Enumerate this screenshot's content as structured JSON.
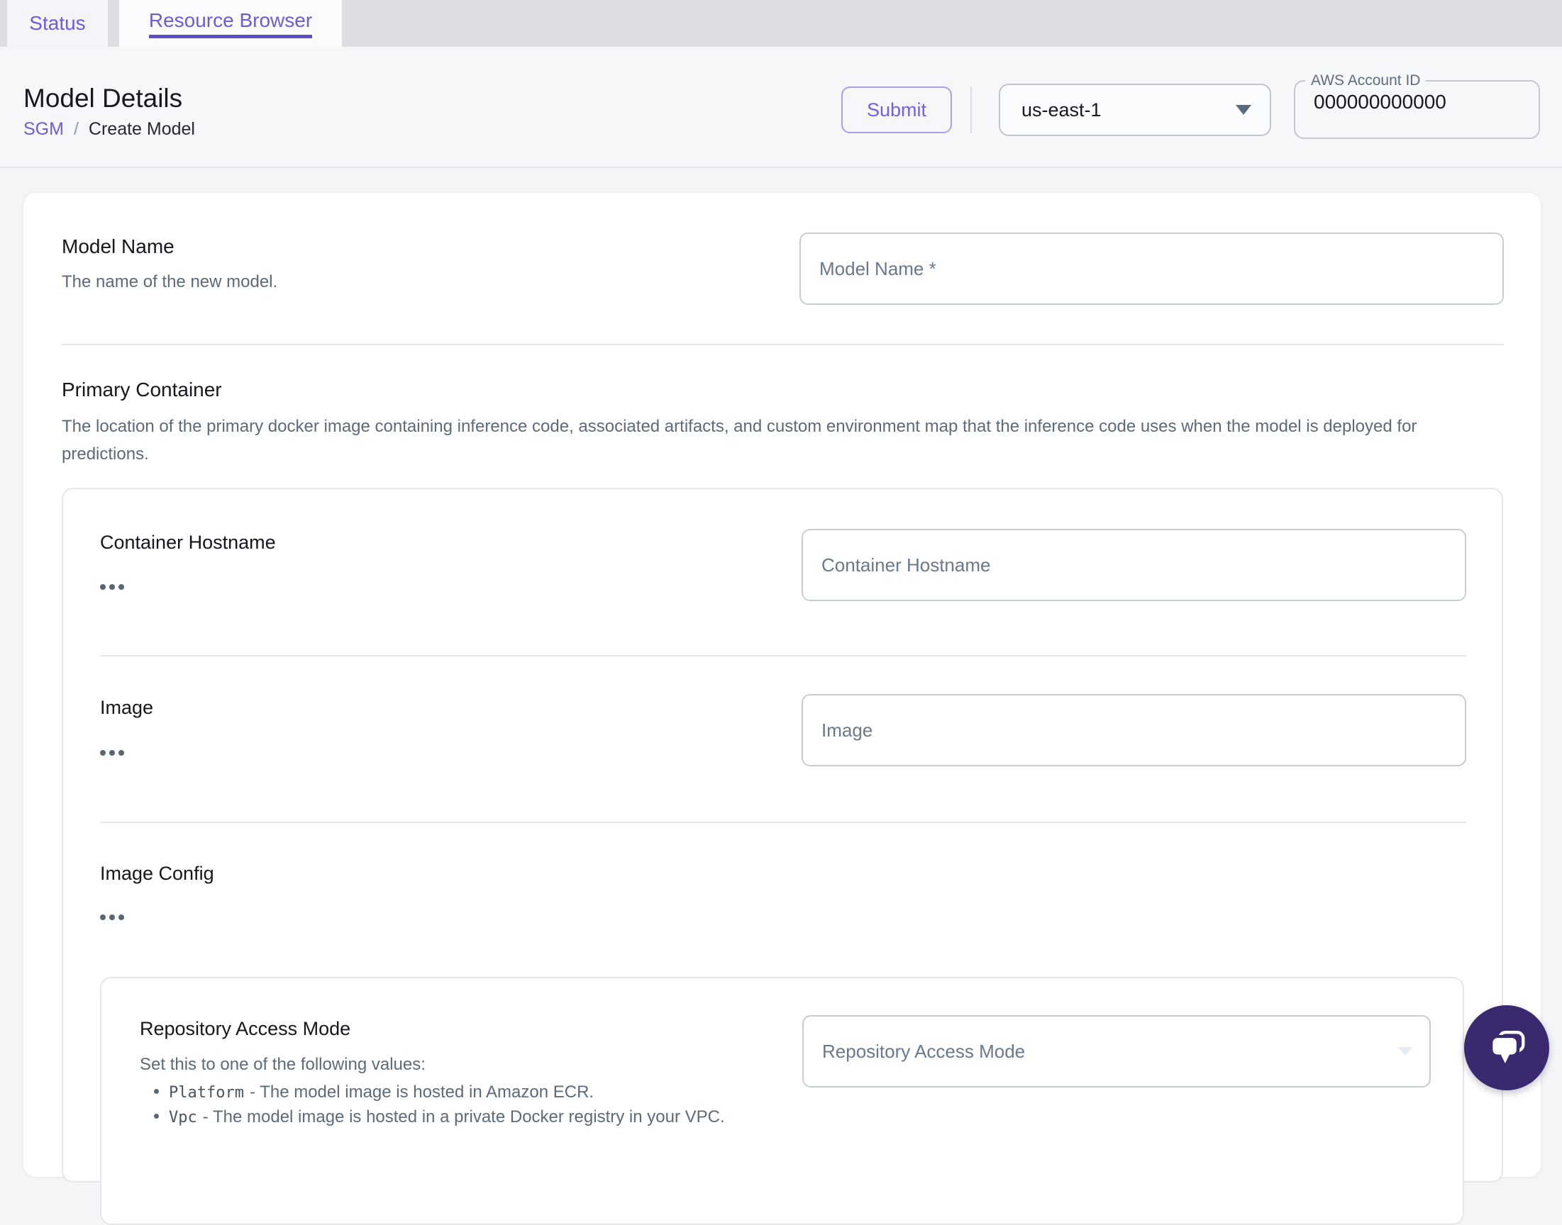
{
  "tabs": {
    "status": "Status",
    "resource_browser": "Resource Browser"
  },
  "header": {
    "title": "Model Details",
    "breadcrumb": {
      "root": "SGM",
      "separator": "/",
      "current": "Create Model"
    },
    "submit_label": "Submit",
    "region_select": {
      "value": "us-east-1"
    },
    "account_field": {
      "label": "AWS Account ID",
      "value": "000000000000"
    }
  },
  "form": {
    "model_name": {
      "label": "Model Name",
      "description": "The name of the new model.",
      "placeholder": "Model Name *"
    },
    "primary_container": {
      "label": "Primary Container",
      "description": "The location of the primary docker image containing inference code, associated artifacts, and custom environment map that the inference code uses when the model is deployed for predictions.",
      "container_hostname": {
        "label": "Container Hostname",
        "placeholder": "Container Hostname"
      },
      "image": {
        "label": "Image",
        "placeholder": "Image"
      },
      "image_config": {
        "label": "Image Config",
        "repository_access_mode": {
          "label": "Repository Access Mode",
          "description": "Set this to one of the following values:",
          "options": [
            {
              "code": "Platform",
              "text": "- The model image is hosted in Amazon ECR."
            },
            {
              "code": "Vpc",
              "text": "- The model image is hosted in a private Docker registry in your VPC."
            }
          ],
          "placeholder": "Repository Access Mode"
        }
      }
    }
  },
  "icons": {
    "ellipsis": "more-options-dots",
    "chevron_down": "chevron-down",
    "chat": "chat-bubbles"
  },
  "colors": {
    "accent_purple": "#6e5bd7",
    "tab_underline": "#5d4fc7",
    "chat_fab": "#3a296f",
    "text_muted": "#5d6a7a",
    "input_border": "#c8cdd4"
  }
}
